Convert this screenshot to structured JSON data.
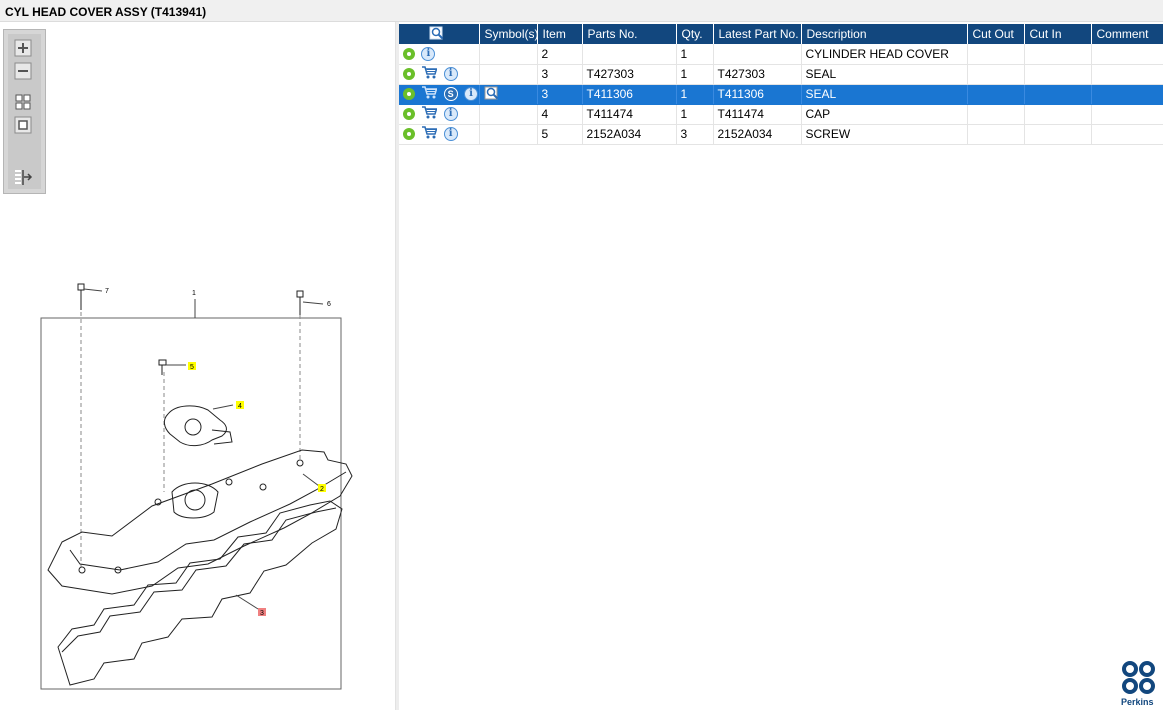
{
  "window": {
    "title": "CYL HEAD COVER ASSY (T413941)"
  },
  "toolbar": {
    "buttons": [
      {
        "icon": "zoom-in-icon"
      },
      {
        "icon": "zoom-out-icon"
      },
      {
        "icon": "fit-all-icon"
      },
      {
        "icon": "fit-page-icon"
      },
      {
        "icon": "export-icon"
      }
    ]
  },
  "drawing": {
    "callouts": [
      "7",
      "1",
      "6",
      "5",
      "4",
      "2",
      "3"
    ]
  },
  "table": {
    "headers": {
      "lookup": "",
      "symbols": "Symbol(s)",
      "item": "Item",
      "parts_no": "Parts No.",
      "qty": "Qty.",
      "latest_part_no": "Latest Part No.",
      "description": "Description",
      "cut_out": "Cut Out",
      "cut_in": "Cut In",
      "comment": "Comment"
    },
    "rows": [
      {
        "item": "2",
        "parts_no": "",
        "qty": "1",
        "latest_part_no": "",
        "description": "CYLINDER HEAD COVER",
        "cut_out": "",
        "cut_in": "",
        "comment": "",
        "selected": false
      },
      {
        "item": "3",
        "parts_no": "T427303",
        "qty": "1",
        "latest_part_no": "T427303",
        "description": "SEAL",
        "cut_out": "",
        "cut_in": "",
        "comment": "",
        "selected": false
      },
      {
        "item": "3",
        "parts_no": "T411306",
        "qty": "1",
        "latest_part_no": "T411306",
        "description": "SEAL",
        "cut_out": "",
        "cut_in": "",
        "comment": "",
        "selected": true
      },
      {
        "item": "4",
        "parts_no": "T411474",
        "qty": "1",
        "latest_part_no": "T411474",
        "description": "CAP",
        "cut_out": "",
        "cut_in": "",
        "comment": "",
        "selected": false
      },
      {
        "item": "5",
        "parts_no": "2152A034",
        "qty": "3",
        "latest_part_no": "2152A034",
        "description": "SCREW",
        "cut_out": "",
        "cut_in": "",
        "comment": "",
        "selected": false
      }
    ],
    "symbol_badge": "S",
    "info_glyph": "i"
  },
  "brand": {
    "name": "Perkins"
  },
  "colors": {
    "header_bg": "#12477e",
    "selected_row": "#1a76d2",
    "gear": "#6bbf2a",
    "callout_yellow": "#ffff00",
    "callout_red": "#f08080"
  }
}
